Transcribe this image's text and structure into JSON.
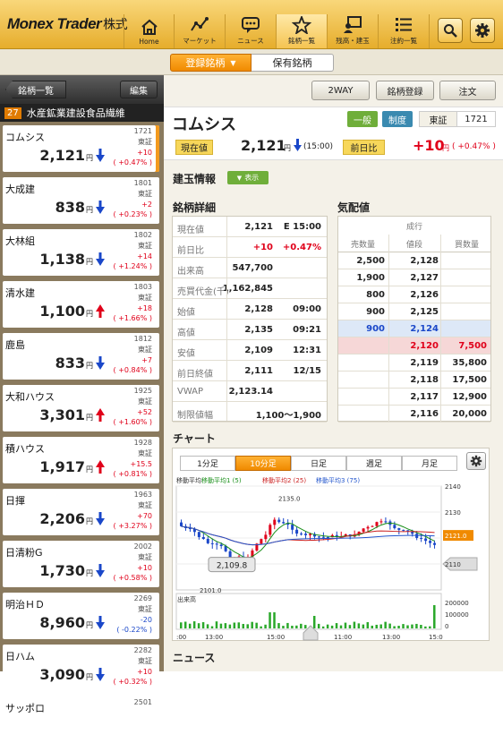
{
  "header": {
    "brand": "Monex Trader",
    "brand_suffix": "株式",
    "nav": [
      {
        "label": "Home",
        "icon": "home-icon"
      },
      {
        "label": "マーケット",
        "icon": "market-chart-icon"
      },
      {
        "label": "ニュース",
        "icon": "news-bubble-icon"
      },
      {
        "label": "銘柄一覧",
        "icon": "star-icon"
      },
      {
        "label": "残高・建玉",
        "icon": "portfolio-icon"
      },
      {
        "label": "注約一覧",
        "icon": "order-list-icon"
      }
    ],
    "search_icon": "search-icon",
    "settings_icon": "gear-icon"
  },
  "subnav": {
    "registered": "登録銘柄",
    "held": "保有銘柄"
  },
  "left": {
    "back_label": "銘柄一覧",
    "edit_label": "編集",
    "sector_num": "27",
    "sector_name": "水産鉱業建設食品繊維",
    "items": [
      {
        "name": "コムシス",
        "code": "1721",
        "exchange": "東証",
        "price": "2,121",
        "yen": "円",
        "dir": "down",
        "change": "+10",
        "pct": "( +0.47% )"
      },
      {
        "name": "大成建",
        "code": "1801",
        "exchange": "東証",
        "price": "838",
        "yen": "円",
        "dir": "down",
        "change": "+2",
        "pct": "( +0.23% )"
      },
      {
        "name": "大林組",
        "code": "1802",
        "exchange": "東証",
        "price": "1,138",
        "yen": "円",
        "dir": "down",
        "change": "+14",
        "pct": "( +1.24% )"
      },
      {
        "name": "清水建",
        "code": "1803",
        "exchange": "東証",
        "price": "1,100",
        "yen": "円",
        "dir": "up",
        "change": "+18",
        "pct": "( +1.66% )"
      },
      {
        "name": "鹿島",
        "code": "1812",
        "exchange": "東証",
        "price": "833",
        "yen": "円",
        "dir": "down",
        "change": "+7",
        "pct": "( +0.84% )"
      },
      {
        "name": "大和ハウス",
        "code": "1925",
        "exchange": "東証",
        "price": "3,301",
        "yen": "円",
        "dir": "up",
        "change": "+52",
        "pct": "( +1.60% )"
      },
      {
        "name": "積ハウス",
        "code": "1928",
        "exchange": "東証",
        "price": "1,917",
        "yen": "円",
        "dir": "up",
        "change": "+15.5",
        "pct": "( +0.81% )"
      },
      {
        "name": "日揮",
        "code": "1963",
        "exchange": "東証",
        "price": "2,206",
        "yen": "円",
        "dir": "down",
        "change": "+70",
        "pct": "( +3.27% )"
      },
      {
        "name": "日清粉G",
        "code": "2002",
        "exchange": "東証",
        "price": "1,730",
        "yen": "円",
        "dir": "down",
        "change": "+10",
        "pct": "( +0.58% )"
      },
      {
        "name": "明治ＨＤ",
        "code": "2269",
        "exchange": "東証",
        "price": "8,960",
        "yen": "円",
        "dir": "down",
        "change": "-20",
        "pct": "( -0.22% )"
      },
      {
        "name": "日ハム",
        "code": "2282",
        "exchange": "東証",
        "price": "3,090",
        "yen": "円",
        "dir": "down",
        "change": "+10",
        "pct": "( +0.32% )"
      },
      {
        "name": "サッポロ",
        "code": "2501",
        "exchange": "",
        "price": "",
        "yen": "",
        "dir": "",
        "change": "",
        "pct": ""
      }
    ]
  },
  "toolbar": {
    "two_way": "2WAY",
    "register": "銘柄登録",
    "order": "注文"
  },
  "stock": {
    "name": "コムシス",
    "tag_general": "一般",
    "tag_system": "制度",
    "exchange": "東証",
    "code": "1721",
    "current_label": "現在値",
    "price": "2,121",
    "price_yen": "円",
    "time": "(15:00)",
    "diff_label": "前日比",
    "change": "+10",
    "change_yen": "円",
    "change_pct": "( +0.47% )"
  },
  "margin": {
    "title": "建玉情報",
    "toggle": "表示"
  },
  "detail": {
    "title": "銘柄詳細",
    "rows": [
      {
        "label": "現在値",
        "value": "2,121",
        "extra": "E 15:00"
      },
      {
        "label": "前日比",
        "value": "+10",
        "extra": "+0.47%"
      },
      {
        "label": "出来高",
        "value": "547,700",
        "extra": ""
      },
      {
        "label": "売買代金(千)",
        "value": "1,162,845",
        "extra": ""
      },
      {
        "label": "始値",
        "value": "2,128",
        "extra": "09:00"
      },
      {
        "label": "高値",
        "value": "2,135",
        "extra": "09:21"
      },
      {
        "label": "安値",
        "value": "2,109",
        "extra": "12:31"
      },
      {
        "label": "前日終値",
        "value": "2,111",
        "extra": "12/15"
      },
      {
        "label": "VWAP",
        "value": "2,123.14",
        "extra": ""
      },
      {
        "label": "制限値幅",
        "value": "1,100～1,900",
        "extra": ""
      }
    ]
  },
  "board": {
    "title": "気配値",
    "top_label": "成行",
    "col_sell": "売数量",
    "col_price": "値段",
    "col_buy": "買数量",
    "rows": [
      {
        "sell": "2,500",
        "price": "2,128",
        "buy": ""
      },
      {
        "sell": "1,900",
        "price": "2,127",
        "buy": ""
      },
      {
        "sell": "800",
        "price": "2,126",
        "buy": ""
      },
      {
        "sell": "900",
        "price": "2,125",
        "buy": ""
      },
      {
        "sell": "900",
        "price": "2,124",
        "buy": ""
      },
      {
        "sell": "",
        "price": "2,120",
        "buy": "7,500"
      },
      {
        "sell": "",
        "price": "2,119",
        "buy": "35,800"
      },
      {
        "sell": "",
        "price": "2,118",
        "buy": "17,500"
      },
      {
        "sell": "",
        "price": "2,117",
        "buy": "12,900"
      },
      {
        "sell": "",
        "price": "2,116",
        "buy": "20,000"
      }
    ]
  },
  "chart": {
    "title": "チャート",
    "timeframes": [
      "1分足",
      "10分足",
      "日足",
      "週足",
      "月足"
    ],
    "active_timeframe": "10分足",
    "legend": [
      "移動平均",
      "移動平均1 (5)",
      "移動平均2 (25)",
      "移動平均3 (75)"
    ],
    "price_axis": [
      "2140",
      "2130",
      "2121.0",
      "2110"
    ],
    "callout_low": "2,109.8",
    "label_high": "2135.0",
    "label_low": "2101.0",
    "volume_label": "出来高",
    "volume_axis": [
      "200000",
      "100000",
      "0"
    ],
    "time_axis": [
      ":00",
      "13:00",
      "15:00",
      "11:00",
      "13:00",
      "15:0"
    ],
    "colors": {
      "up": "#e0001a",
      "down": "#1a47c9",
      "ma1": "#1a8f1a",
      "ma2": "#cc2222",
      "ma3": "#2255cc"
    }
  },
  "news": {
    "title": "ニュース"
  },
  "chart_data": {
    "type": "candlestick",
    "series": [
      {
        "name": "移動平均1 (5)"
      },
      {
        "name": "移動平均2 (25)"
      },
      {
        "name": "移動平均3 (75)"
      }
    ],
    "ylim": [
      2100,
      2140
    ],
    "high": 2135.0,
    "low": 2101.0,
    "current": 2121.0
  }
}
